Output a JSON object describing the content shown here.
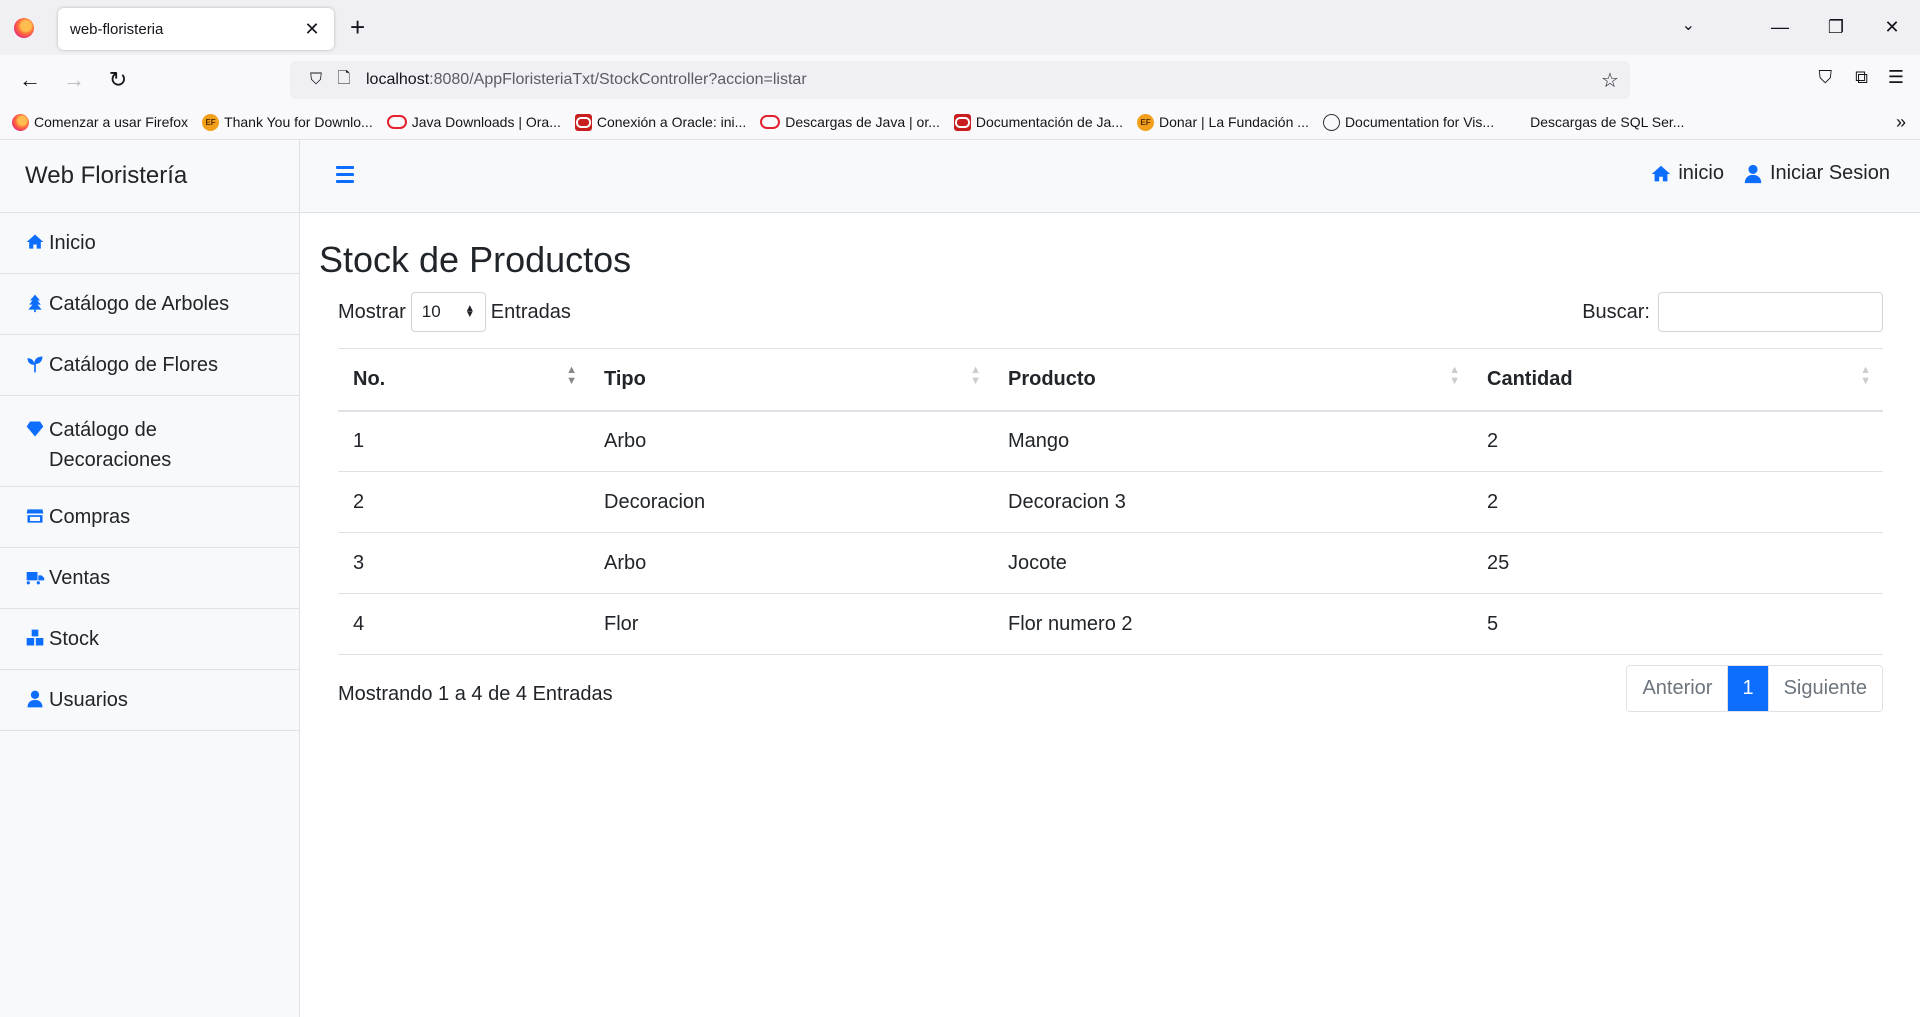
{
  "browser": {
    "tab_title": "web-floristeria",
    "url_host": "localhost",
    "url_rest": ":8080/AppFloristeriaTxt/StockController?accion=listar",
    "bookmarks": [
      {
        "label": "Comenzar a usar Firefox",
        "icon": "firefox-icon"
      },
      {
        "label": "Thank You for Downlo...",
        "icon": "ef-icon"
      },
      {
        "label": "Java Downloads | Ora...",
        "icon": "oracle-oval-icon"
      },
      {
        "label": "Conexión a Oracle: ini...",
        "icon": "oracle-box-icon"
      },
      {
        "label": "Descargas de Java | or...",
        "icon": "oracle-oval-icon"
      },
      {
        "label": "Documentación de Ja...",
        "icon": "oracle-box-icon"
      },
      {
        "label": "Donar | La Fundación ...",
        "icon": "ef-icon"
      },
      {
        "label": "Documentation for Vis...",
        "icon": "globe-icon"
      },
      {
        "label": "Descargas de SQL Ser...",
        "icon": "microsoft-icon"
      }
    ]
  },
  "sidebar": {
    "brand": "Web Floristería",
    "items": [
      {
        "label": "Inicio",
        "icon": "home-icon"
      },
      {
        "label": "Catálogo de Arboles",
        "icon": "tree-icon"
      },
      {
        "label": "Catálogo de Flores",
        "icon": "seedling-icon"
      },
      {
        "label": "Catálogo de Decoraciones",
        "icon": "gem-icon"
      },
      {
        "label": "Compras",
        "icon": "store-icon"
      },
      {
        "label": "Ventas",
        "icon": "truck-icon"
      },
      {
        "label": "Stock",
        "icon": "boxes-icon"
      },
      {
        "label": "Usuarios",
        "icon": "user-icon"
      }
    ]
  },
  "topnav": {
    "home_label": "inicio",
    "login_label": "Iniciar Sesion"
  },
  "page": {
    "title": "Stock de Productos",
    "show_label": "Mostrar",
    "page_size": "10",
    "entries_label": "Entradas",
    "search_label": "Buscar:",
    "search_value": ""
  },
  "table": {
    "headers": [
      "No.",
      "Tipo",
      "Producto",
      "Cantidad"
    ],
    "rows": [
      [
        "1",
        "Arbo",
        "Mango",
        "2"
      ],
      [
        "2",
        "Decoracion",
        "Decoracion 3",
        "2"
      ],
      [
        "3",
        "Arbo",
        "Jocote",
        "25"
      ],
      [
        "4",
        "Flor",
        "Flor numero 2",
        "5"
      ]
    ]
  },
  "footer": {
    "info": "Mostrando 1 a 4 de 4 Entradas",
    "prev": "Anterior",
    "current": "1",
    "next": "Siguiente"
  },
  "colors": {
    "accent": "#0d6efd"
  }
}
